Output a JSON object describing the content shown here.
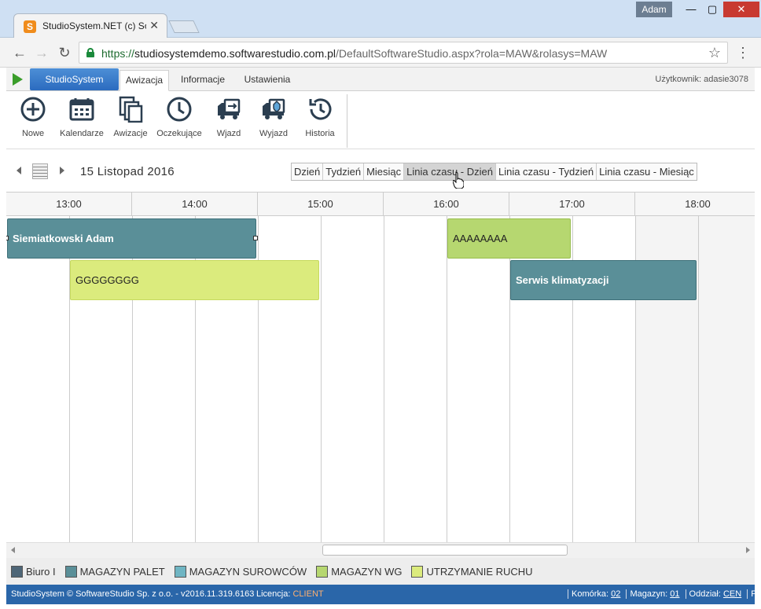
{
  "browser": {
    "tab_title": "StudioSystem.NET (c) Sof",
    "user": "Adam",
    "url_scheme": "https://",
    "url_host": "studiosystemdemo.softwarestudio.com.pl",
    "url_path": "/DefaultSoftwareStudio.aspx?rola=MAW&rolasys=MAW"
  },
  "appnav": {
    "brand": "StudioSystem",
    "menu": [
      "Awizacja",
      "Informacje",
      "Ustawienia"
    ],
    "user_label": "Użytkownik: adasie3078"
  },
  "toolbar": {
    "items": [
      {
        "label": "Nowe",
        "icon": "plus-circle-icon"
      },
      {
        "label": "Kalendarze",
        "icon": "calendar-icon"
      },
      {
        "label": "Awizacje",
        "icon": "documents-icon"
      },
      {
        "label": "Oczekujące",
        "icon": "clock-icon"
      },
      {
        "label": "Wjazd",
        "icon": "truck-in-icon"
      },
      {
        "label": "Wyjazd",
        "icon": "truck-out-icon"
      },
      {
        "label": "Historia",
        "icon": "history-icon"
      }
    ]
  },
  "datebar": {
    "date": "15 Listopad 2016",
    "views": [
      "Dzień",
      "Tydzień",
      "Miesiąc",
      "Linia czasu - Dzień",
      "Linia czasu - Tydzień",
      "Linia czasu - Miesiąc"
    ],
    "active_view": "Linia czasu - Dzień"
  },
  "timeline": {
    "hours": [
      "13:00",
      "14:00",
      "15:00",
      "16:00",
      "17:00",
      "18:00"
    ],
    "events": [
      {
        "label": "Siemiatkowski Adam",
        "start": "12:30",
        "end": "14:30",
        "category": "MAGAZYN PALET",
        "selected": true
      },
      {
        "label": "GGGGGGGG",
        "start": "13:00",
        "end": "15:00",
        "category": "UTRZYMANIE RUCHU"
      },
      {
        "label": "AAAAAAAA",
        "start": "16:00",
        "end": "17:00",
        "category": "MAGAZYN WG"
      },
      {
        "label": "Serwis klimatyzacji",
        "start": "16:30",
        "end": "18:00",
        "category": "MAGAZYN PALET"
      }
    ]
  },
  "legend": [
    {
      "label": "Biuro I",
      "color": "#4e6677"
    },
    {
      "label": "MAGAZYN PALET",
      "color": "#5a8f98"
    },
    {
      "label": "MAGAZYN SUROWCÓW",
      "color": "#6fb5c3"
    },
    {
      "label": "MAGAZYN WG",
      "color": "#b6d770"
    },
    {
      "label": "UTRZYMANIE RUCHU",
      "color": "#dbeb7d"
    }
  ],
  "status": {
    "copyright": "StudioSystem © SoftwareStudio Sp. z o.o. - v2016.11.319.6163",
    "license_label": "Licencja:",
    "license_value": "CLIENT",
    "komorka_label": "Komórka:",
    "komorka_value": "02",
    "magazyn_label": "Magazyn:",
    "magazyn_value": "01",
    "oddzial_label": "Oddział:",
    "oddzial_value": "CEN",
    "firma_label": "Firma:"
  },
  "colors": {
    "accent": "#2a66a9",
    "event_dark": "#5a8f98",
    "event_green": "#b6d770",
    "event_yellow": "#dbeb7d"
  }
}
